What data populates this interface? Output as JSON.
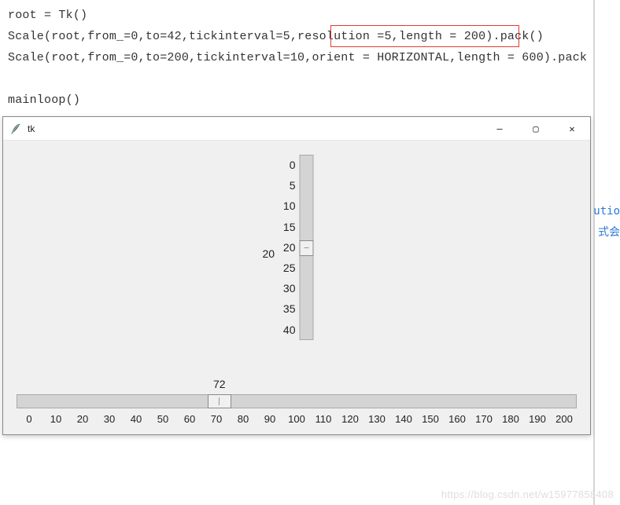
{
  "code": {
    "line1": "root = Tk()",
    "line2": "Scale(root,from_=0,to=42,tickinterval=5,resolution =5,length = 200).pack()",
    "line3": "Scale(root,from_=0,to=200,tickinterval=10,orient = HORIZONTAL,length = 600).pack",
    "line4": "mainloop()"
  },
  "window": {
    "title": "tk",
    "minimize_glyph": "—",
    "maximize_glyph": "▢",
    "close_glyph": "✕"
  },
  "vertical_scale": {
    "value": "20",
    "ticks": [
      "0",
      "5",
      "10",
      "15",
      "20",
      "25",
      "30",
      "35",
      "40"
    ]
  },
  "horizontal_scale": {
    "value": "72",
    "ticks": [
      "0",
      "10",
      "20",
      "30",
      "40",
      "50",
      "60",
      "70",
      "80",
      "90",
      "100",
      "110",
      "120",
      "130",
      "140",
      "150",
      "160",
      "170",
      "180",
      "190",
      "200"
    ]
  },
  "sidebar_fragments": [
    "utio",
    "式会"
  ],
  "watermark": "https://blog.csdn.net/w15977858408"
}
